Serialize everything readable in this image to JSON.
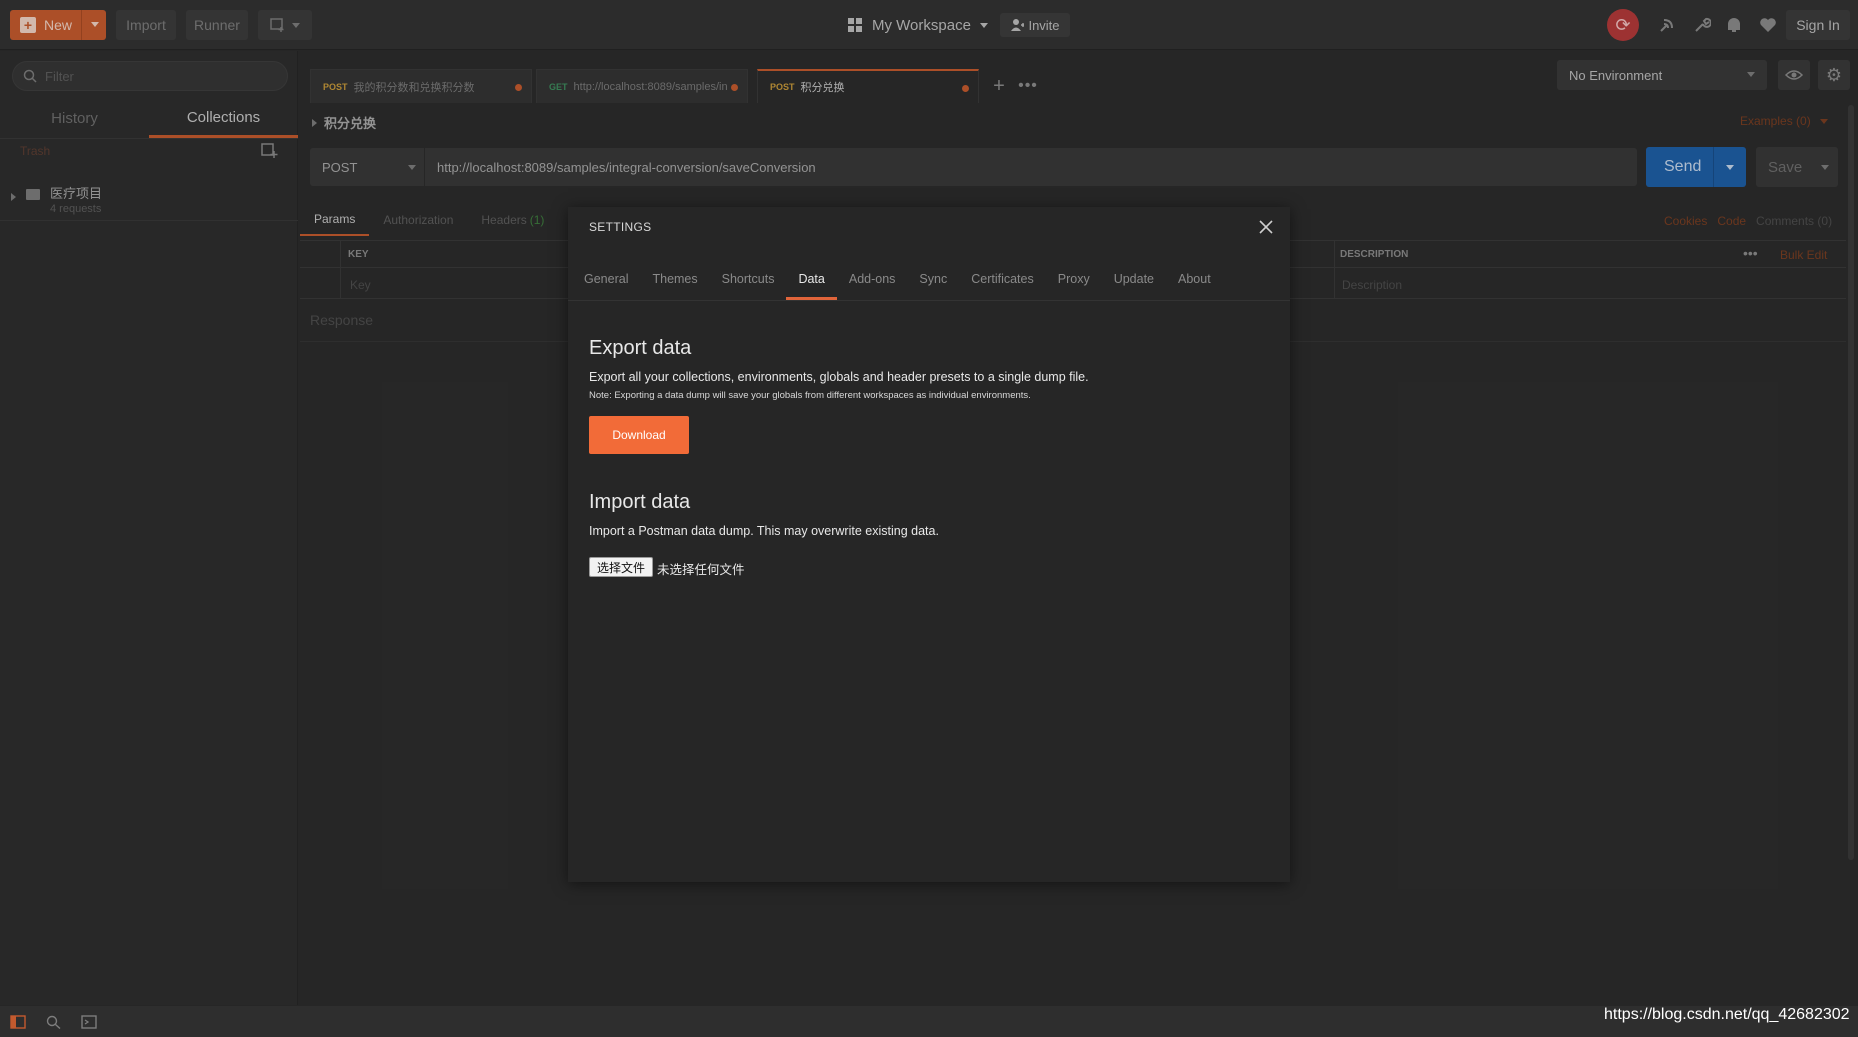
{
  "header": {
    "new_label": "New",
    "import_label": "Import",
    "runner_label": "Runner",
    "workspace_label": "My Workspace",
    "invite_label": "Invite",
    "sign_in_label": "Sign In"
  },
  "sidebar": {
    "filter_placeholder": "Filter",
    "tabs": [
      "History",
      "Collections"
    ],
    "active_tab": "Collections",
    "trash_label": "Trash",
    "collections": [
      {
        "name": "医疗项目",
        "requests": "4 requests"
      }
    ]
  },
  "request_tabs": [
    {
      "method": "POST",
      "title": "我的积分数和兑换积分数",
      "method_color": "#c89a3a"
    },
    {
      "method": "GET",
      "title": "http://localhost:8089/samples/in",
      "method_color": "#3e8e5e"
    },
    {
      "method": "POST",
      "title": "积分兑换",
      "method_color": "#c89a3a",
      "active": true
    }
  ],
  "environment": {
    "selected": "No Environment"
  },
  "request": {
    "name": "积分兑换",
    "examples_label": "Examples (0)",
    "method": "POST",
    "url": "http://localhost:8089/samples/integral-conversion/saveConversion",
    "send_label": "Send",
    "save_label": "Save",
    "tabs": {
      "params": "Params",
      "authorization": "Authorization",
      "headers": "Headers",
      "headers_count": "(1)"
    },
    "links": {
      "cookies": "Cookies",
      "code": "Code",
      "comments": "Comments (0)"
    },
    "params_table": {
      "key_header": "KEY",
      "description_header": "DESCRIPTION",
      "bulk_edit": "Bulk Edit",
      "key_placeholder": "Key",
      "description_placeholder": "Description"
    },
    "response_label": "Response"
  },
  "settings_modal": {
    "title": "SETTINGS",
    "tabs": [
      "General",
      "Themes",
      "Shortcuts",
      "Data",
      "Add-ons",
      "Sync",
      "Certificates",
      "Proxy",
      "Update",
      "About"
    ],
    "active_tab": "Data",
    "export": {
      "heading": "Export data",
      "description": "Export all your collections, environments, globals and header presets to a single dump file.",
      "note": "Note: Exporting a data dump will save your globals from different workspaces as individual environments.",
      "button": "Download"
    },
    "import": {
      "heading": "Import data",
      "description": "Import a Postman data dump. This may overwrite existing data.",
      "file_button": "选择文件",
      "file_status": "未选择任何文件"
    }
  },
  "watermark": "https://blog.csdn.net/qq_42682302",
  "colors": {
    "accent": "#f26b38",
    "send_blue": "#1e5fa6",
    "sync_red": "#b33a3a"
  }
}
